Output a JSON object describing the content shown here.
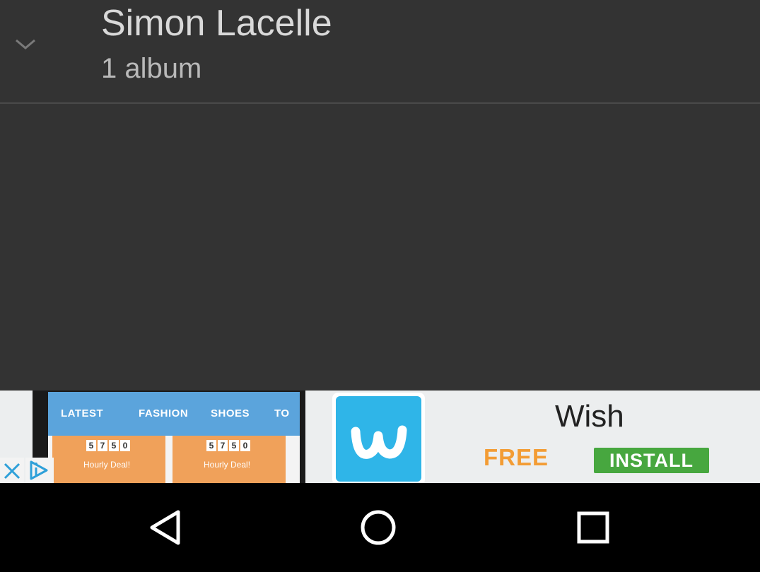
{
  "artist": {
    "name": "Simon Lacelle",
    "album_count": "1 album",
    "expand_icon": "chevron-down-icon"
  },
  "ad": {
    "tabs": [
      "LATEST",
      "FASHION",
      "SHOES",
      "TO"
    ],
    "deal_digits": [
      "5",
      "7",
      "5",
      "0"
    ],
    "deal_label": "Hourly Deal!",
    "brand": "Wish",
    "price_label": "FREE",
    "cta_label": "INSTALL",
    "logo_icon": "wish-logo-icon",
    "close_icon": "close-icon",
    "choices_icon": "adchoices-icon",
    "colors": {
      "brand_blue": "#2fb5e8",
      "install_green": "#47a73f",
      "free_orange": "#f39c34"
    }
  },
  "nav": {
    "back_icon": "back-icon",
    "home_icon": "home-icon",
    "recents_icon": "recents-icon"
  }
}
